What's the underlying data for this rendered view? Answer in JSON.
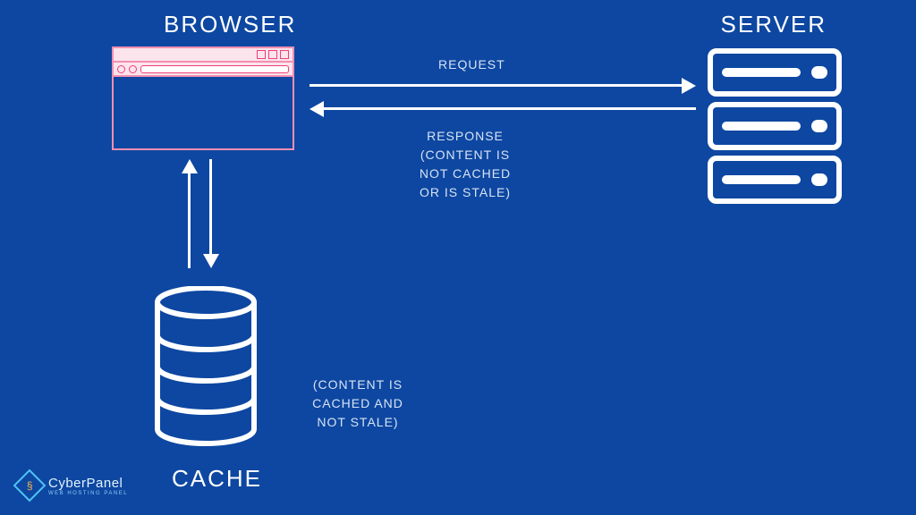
{
  "labels": {
    "browser": "BROWSER",
    "server": "SERVER",
    "cache": "CACHE"
  },
  "annotations": {
    "request": "REQUEST",
    "response": "RESPONSE\n(CONTENT IS\nNOT CACHED\nOR IS STALE)",
    "cache_hit": "(CONTENT IS\nCACHED AND\nNOT STALE)"
  },
  "brand": {
    "name": "CyberPanel",
    "tagline": "WEB HOSTING PANEL"
  },
  "diagram": {
    "nodes": [
      "browser",
      "server",
      "cache"
    ],
    "edges": [
      {
        "from": "browser",
        "to": "server",
        "label": "request"
      },
      {
        "from": "server",
        "to": "browser",
        "label": "response (content is not cached or is stale)"
      },
      {
        "from": "browser",
        "to": "cache",
        "bidirectional": true,
        "label": "(content is cached and not stale)"
      }
    ]
  }
}
